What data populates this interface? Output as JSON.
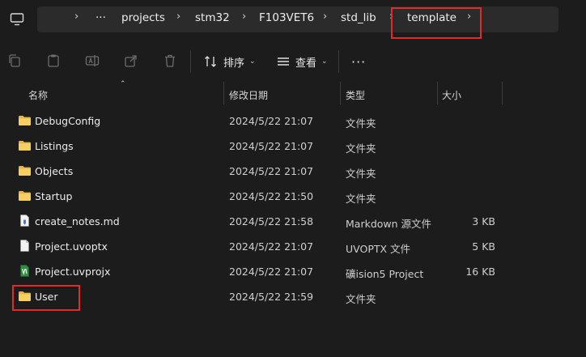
{
  "breadcrumbs": [
    {
      "label": "projects"
    },
    {
      "label": "stm32"
    },
    {
      "label": "F103VET6"
    },
    {
      "label": "std_lib"
    },
    {
      "label": "template"
    }
  ],
  "addr": {
    "more": "···"
  },
  "toolbar": {
    "sort_label": "排序",
    "view_label": "查看",
    "more_label": "···"
  },
  "columns": {
    "name": "名称",
    "date": "修改日期",
    "type": "类型",
    "size": "大小"
  },
  "files": [
    {
      "name": "DebugConfig",
      "date": "2024/5/22 21:07",
      "type": "文件夹",
      "size": "",
      "icon": "folder-icon"
    },
    {
      "name": "Listings",
      "date": "2024/5/22 21:07",
      "type": "文件夹",
      "size": "",
      "icon": "folder-icon"
    },
    {
      "name": "Objects",
      "date": "2024/5/22 21:07",
      "type": "文件夹",
      "size": "",
      "icon": "folder-icon"
    },
    {
      "name": "Startup",
      "date": "2024/5/22 21:50",
      "type": "文件夹",
      "size": "",
      "icon": "folder-icon"
    },
    {
      "name": "create_notes.md",
      "date": "2024/5/22 21:58",
      "type": "Markdown 源文件",
      "size": "3 KB",
      "icon": "markdown-file-icon"
    },
    {
      "name": "Project.uvoptx",
      "date": "2024/5/22 21:07",
      "type": "UVOPTX 文件",
      "size": "5 KB",
      "icon": "file-icon"
    },
    {
      "name": "Project.uvprojx",
      "date": "2024/5/22 21:07",
      "type": "礦ision5 Project",
      "size": "16 KB",
      "icon": "keil-project-icon"
    },
    {
      "name": "User",
      "date": "2024/5/22 21:59",
      "type": "文件夹",
      "size": "",
      "icon": "folder-icon"
    }
  ],
  "colors": {
    "background": "#1c1c1c",
    "address_bar": "#2b2b2b",
    "folder": "#f4c95d",
    "highlight_box": "#e22a2a"
  }
}
